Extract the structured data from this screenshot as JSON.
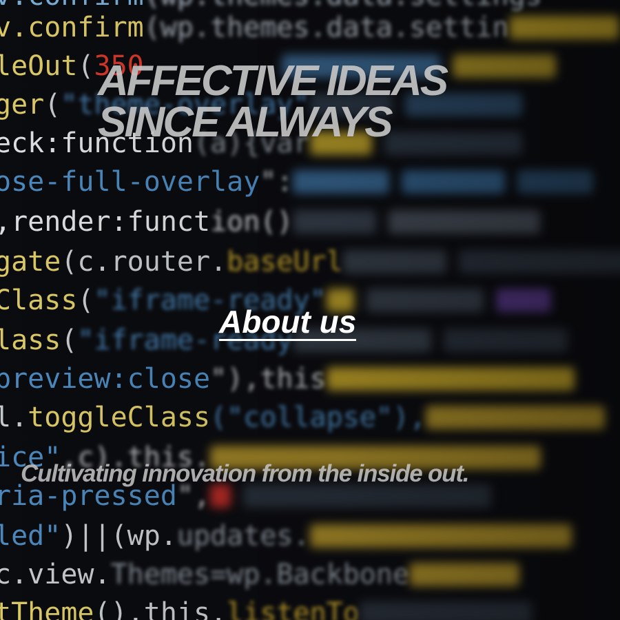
{
  "hero": {
    "line1": "AFFECTIVE IDEAS",
    "line2": "SINCE ALWAYS"
  },
  "nav": {
    "about_label": "About us"
  },
  "tagline": "Cultivating innovation from the inside out."
}
